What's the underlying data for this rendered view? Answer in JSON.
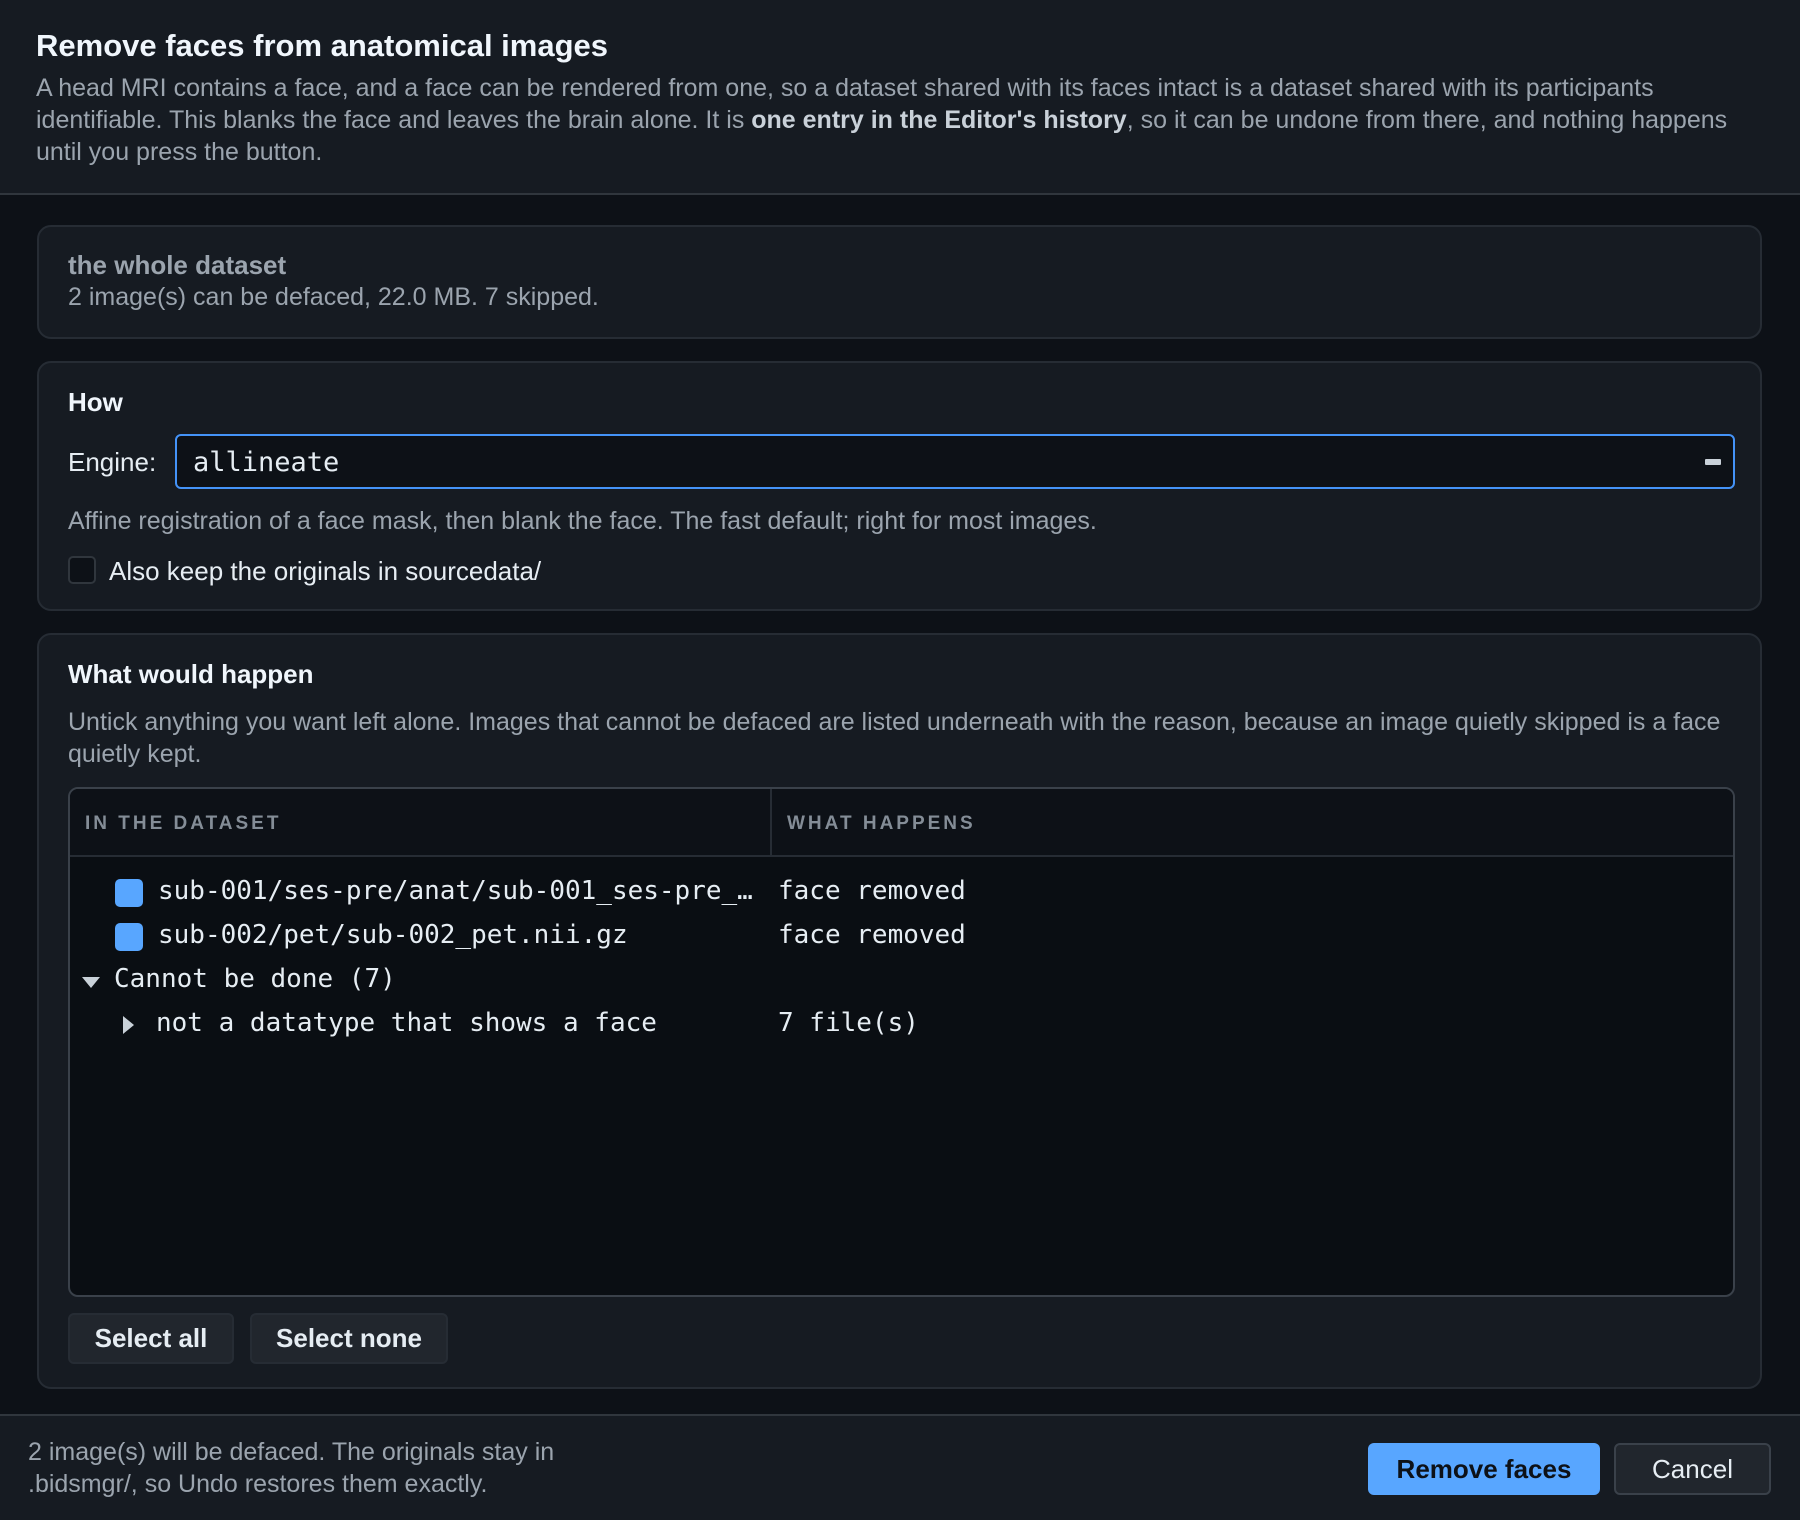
{
  "dialog": {
    "title": "Remove faces from anatomical images",
    "desc_before": "A head MRI contains a face, and a face can be rendered from one, so a dataset shared with its faces intact is a dataset shared with its participants identifiable. This blanks the face and leaves the brain alone. It is ",
    "desc_bold": "one entry in the Editor's history",
    "desc_after": ", so it can be undone from there, and nothing happens until you press the button."
  },
  "scope": {
    "title": "the whole dataset",
    "summary": "2 image(s) can be defaced, 22.0 MB. 7 skipped."
  },
  "how": {
    "title": "How",
    "engine_label": "Engine:",
    "engine_value": "allineate",
    "engine_help": "Affine registration of a face mask, then blank the face. The fast default; right for most images.",
    "keep_originals_label": "Also keep the originals in sourcedata/",
    "keep_originals_checked": false
  },
  "preview": {
    "title": "What would happen",
    "explain": "Untick anything you want left alone. Images that cannot be defaced are listed underneath with the reason, because an image quietly skipped is a face quietly kept.",
    "columns": [
      "IN THE DATASET",
      "WHAT HAPPENS"
    ],
    "rows": [
      {
        "path": "sub-001/ses-pre/anat/sub-001_ses-pre_…",
        "what": "face removed",
        "checked": true
      },
      {
        "path": "sub-002/pet/sub-002_pet.nii.gz",
        "what": "face removed",
        "checked": true
      }
    ],
    "skipped_group": {
      "label": "Cannot be done (7)",
      "reasons": [
        {
          "label": "not a datatype that shows a face",
          "count": "7 file(s)"
        }
      ]
    },
    "select_all": "Select all",
    "select_none": "Select none"
  },
  "footer": {
    "status": "2 image(s) will be defaced. The originals stay in .bidsmgr/, so Undo restores them exactly.",
    "primary": "Remove faces",
    "cancel": "Cancel"
  },
  "colors": {
    "accent": "#58a6ff",
    "background": "#0d1117",
    "panel": "#161b22"
  }
}
